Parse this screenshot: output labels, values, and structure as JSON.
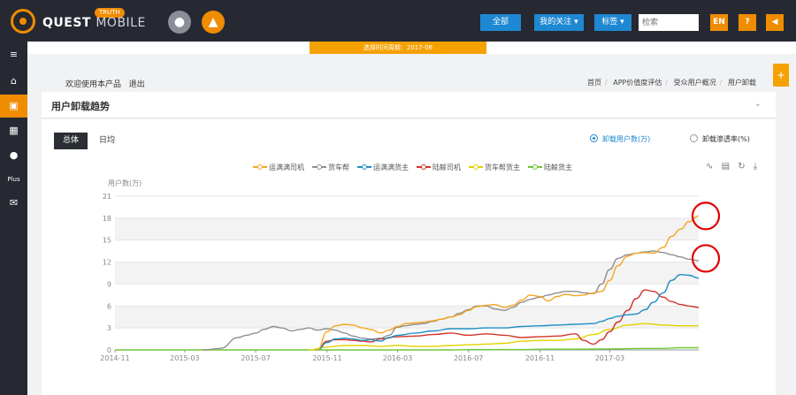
{
  "header": {
    "brand": "QUEST",
    "brand_sub": "MOBILE",
    "truth_badge": "TRUTH",
    "os_icons": [
      "apple-icon",
      "android-icon"
    ],
    "nav": {
      "all_label": "全部",
      "follow_label": "我的关注 ▾",
      "tag_label": "标签 ▾",
      "search_placeholder": "检索",
      "en_label": "EN",
      "help_label": "?",
      "sound_label": "◀"
    }
  },
  "period_label": "选择时间周期：2017-06",
  "sidebar": {
    "items": [
      {
        "icon": "menu-icon",
        "label": "≡"
      },
      {
        "icon": "home-icon",
        "label": "⌂"
      },
      {
        "icon": "briefcase-icon",
        "label": "▣"
      },
      {
        "icon": "grid-icon",
        "label": "▦"
      },
      {
        "icon": "user-icon",
        "label": "●"
      },
      {
        "icon": "plus-text",
        "label": "Plus"
      },
      {
        "icon": "mail-icon",
        "label": "✉"
      }
    ]
  },
  "welcome": {
    "text": "欢迎使用本产品",
    "logout": "退出"
  },
  "breadcrumb": [
    "首页",
    "APP价值度评估",
    "受众用户概况",
    "用户卸载"
  ],
  "floating_add": "+",
  "card": {
    "title": "用户卸载趋势",
    "tabs": {
      "total": "总体",
      "daily": "日均"
    },
    "radios": {
      "users": "卸载用户数(万)",
      "rate": "卸载渗透率(%)"
    }
  },
  "colors": {
    "accent": "#f08c00",
    "topbar": "#262932",
    "button_blue": "#1e88d2",
    "annotation_red": "#e00000"
  },
  "chart_data": {
    "type": "line",
    "ylabel": "用户数(万)",
    "ylim": [
      0,
      21
    ],
    "yticks": [
      0,
      3,
      6,
      9,
      12,
      15,
      18,
      21
    ],
    "xlim": [
      "2014-11",
      "2017-08"
    ],
    "xticks": [
      "2014-11",
      "2015-03",
      "2015-07",
      "2015-11",
      "2016-03",
      "2016-07",
      "2016-11",
      "2017-03"
    ],
    "grid": "horizontal-bands",
    "legend_placement": "top",
    "annotations": [
      {
        "shape": "circle",
        "at": {
          "x": "2017-08",
          "y": 18.3
        }
      },
      {
        "shape": "circle",
        "at": {
          "x": "2017-08",
          "y": 12.5
        }
      }
    ],
    "series": [
      {
        "name": "运满满司机",
        "color": "#f5a623",
        "x": [
          "2015-10-15",
          "2015-11-01",
          "2015-11-15",
          "2015-12-01",
          "2015-12-15",
          "2016-01-01",
          "2016-01-15",
          "2016-02-01",
          "2016-02-15",
          "2016-03-01",
          "2016-03-15",
          "2016-04-01",
          "2016-04-15",
          "2016-05-01",
          "2016-05-15",
          "2016-06-01",
          "2016-06-15",
          "2016-07-01",
          "2016-07-15",
          "2016-08-01",
          "2016-08-15",
          "2016-09-01",
          "2016-09-15",
          "2016-10-01",
          "2016-10-15",
          "2016-11-01",
          "2016-11-15",
          "2016-12-01",
          "2016-12-15",
          "2017-01-01",
          "2017-01-15",
          "2017-02-01",
          "2017-02-15",
          "2017-03-01",
          "2017-03-15",
          "2017-04-01",
          "2017-04-15",
          "2017-05-01",
          "2017-05-15",
          "2017-06-01",
          "2017-06-15",
          "2017-07-01",
          "2017-07-15",
          "2017-08-01"
        ],
        "values": [
          0,
          2.5,
          3.3,
          3.5,
          3.4,
          3.0,
          2.8,
          2.3,
          2.7,
          3.2,
          3.6,
          3.7,
          3.8,
          4.0,
          4.2,
          4.5,
          4.8,
          5.4,
          5.9,
          6.1,
          6.2,
          5.8,
          6.1,
          6.8,
          7.5,
          7.3,
          6.7,
          7.3,
          7.6,
          7.4,
          7.5,
          7.8,
          8.0,
          9.5,
          11.5,
          12.8,
          13.2,
          13.3,
          13.2,
          14.0,
          15.5,
          16.5,
          17.5,
          18.3
        ]
      },
      {
        "name": "货车帮",
        "color": "#8e8e93",
        "x": [
          "2015-04-01",
          "2015-05-01",
          "2015-06-01",
          "2015-06-15",
          "2015-07-01",
          "2015-07-15",
          "2015-08-01",
          "2015-08-15",
          "2015-09-01",
          "2015-09-15",
          "2015-10-01",
          "2015-10-15",
          "2015-11-01",
          "2015-11-15",
          "2015-12-01",
          "2015-12-15",
          "2016-01-01",
          "2016-01-15",
          "2016-02-01",
          "2016-02-15",
          "2016-03-01",
          "2016-03-15",
          "2016-04-01",
          "2016-04-15",
          "2016-05-01",
          "2016-05-15",
          "2016-06-01",
          "2016-06-15",
          "2016-07-01",
          "2016-07-15",
          "2016-08-01",
          "2016-08-15",
          "2016-09-01",
          "2016-09-15",
          "2016-10-01",
          "2016-10-15",
          "2016-11-01",
          "2016-11-15",
          "2016-12-01",
          "2016-12-15",
          "2017-01-01",
          "2017-01-15",
          "2017-02-01",
          "2017-02-15",
          "2017-03-01",
          "2017-03-15",
          "2017-04-01",
          "2017-04-15",
          "2017-05-01",
          "2017-05-15",
          "2017-06-01",
          "2017-06-15",
          "2017-07-01",
          "2017-07-15",
          "2017-08-01"
        ],
        "values": [
          0,
          0.2,
          1.7,
          2.0,
          2.3,
          2.8,
          3.2,
          3.0,
          2.6,
          2.8,
          3.0,
          2.7,
          2.9,
          2.7,
          2.3,
          1.9,
          1.6,
          1.5,
          1.6,
          2.0,
          3.1,
          3.3,
          3.5,
          3.6,
          3.9,
          4.2,
          4.5,
          5.0,
          5.5,
          6.0,
          6.0,
          5.6,
          5.4,
          5.8,
          6.5,
          6.9,
          7.2,
          7.5,
          7.8,
          8.0,
          8.0,
          7.8,
          7.7,
          9.0,
          11.0,
          12.5,
          13.0,
          13.2,
          13.4,
          13.5,
          13.3,
          13.0,
          12.7,
          12.4,
          12.2
        ]
      },
      {
        "name": "运满满货主",
        "color": "#1e8fc6",
        "x": [
          "2015-10-15",
          "2015-11-01",
          "2015-11-15",
          "2015-12-01",
          "2015-12-15",
          "2016-01-01",
          "2016-01-15",
          "2016-02-01",
          "2016-02-15",
          "2016-03-01",
          "2016-04-01",
          "2016-05-01",
          "2016-06-01",
          "2016-07-01",
          "2016-08-01",
          "2016-09-01",
          "2016-10-01",
          "2016-11-01",
          "2016-12-01",
          "2017-01-01",
          "2017-02-01",
          "2017-02-15",
          "2017-03-01",
          "2017-03-15",
          "2017-04-01",
          "2017-04-15",
          "2017-05-01",
          "2017-05-15",
          "2017-06-01",
          "2017-06-15",
          "2017-07-01",
          "2017-07-15",
          "2017-08-01"
        ],
        "values": [
          0,
          1.0,
          1.5,
          1.6,
          1.5,
          1.3,
          1.4,
          1.2,
          1.7,
          2.0,
          2.3,
          2.6,
          2.9,
          2.9,
          3.0,
          3.0,
          3.2,
          3.3,
          3.4,
          3.5,
          3.6,
          3.9,
          4.3,
          4.6,
          4.8,
          4.9,
          5.5,
          6.5,
          7.8,
          9.5,
          10.3,
          10.2,
          9.8
        ]
      },
      {
        "name": "陆鲸司机",
        "color": "#d0342c",
        "x": [
          "2015-10-15",
          "2015-11-01",
          "2015-11-15",
          "2015-12-01",
          "2015-12-15",
          "2016-01-01",
          "2016-01-15",
          "2016-02-01",
          "2016-03-01",
          "2016-04-01",
          "2016-05-01",
          "2016-06-01",
          "2016-07-01",
          "2016-08-01",
          "2016-09-01",
          "2016-10-01",
          "2016-11-01",
          "2016-12-01",
          "2017-01-01",
          "2017-01-15",
          "2017-02-01",
          "2017-02-15",
          "2017-03-01",
          "2017-03-15",
          "2017-04-01",
          "2017-04-15",
          "2017-05-01",
          "2017-05-15",
          "2017-06-01",
          "2017-06-15",
          "2017-07-01",
          "2017-07-15",
          "2017-08-01"
        ],
        "values": [
          0,
          1.2,
          1.4,
          1.4,
          1.3,
          1.2,
          1.1,
          1.5,
          1.8,
          1.9,
          2.1,
          2.3,
          2.0,
          2.2,
          2.0,
          1.7,
          1.8,
          1.9,
          2.2,
          1.3,
          0.8,
          1.4,
          2.5,
          3.8,
          5.4,
          7.0,
          8.2,
          8.0,
          7.2,
          6.6,
          6.2,
          6.0,
          5.8
        ]
      },
      {
        "name": "货车帮货主",
        "color": "#e2d200",
        "x": [
          "2015-10-01",
          "2015-11-01",
          "2015-12-01",
          "2016-01-01",
          "2016-02-01",
          "2016-03-01",
          "2016-04-01",
          "2016-05-01",
          "2016-06-01",
          "2016-07-01",
          "2016-08-01",
          "2016-09-01",
          "2016-10-01",
          "2016-11-01",
          "2016-12-01",
          "2017-01-01",
          "2017-02-01",
          "2017-03-01",
          "2017-04-01",
          "2017-05-01",
          "2017-06-01",
          "2017-07-01",
          "2017-08-01"
        ],
        "values": [
          0,
          0.4,
          0.6,
          0.6,
          0.5,
          0.6,
          0.5,
          0.5,
          0.6,
          0.7,
          0.8,
          0.9,
          1.2,
          1.3,
          1.3,
          1.5,
          2.1,
          2.8,
          3.4,
          3.6,
          3.4,
          3.3,
          3.3
        ]
      },
      {
        "name": "陆鲸货主",
        "color": "#6fc936",
        "x": [
          "2014-11-01",
          "2016-06-01",
          "2016-07-01",
          "2016-10-01",
          "2016-11-01",
          "2017-01-01",
          "2017-03-01",
          "2017-05-01",
          "2017-06-01",
          "2017-07-01",
          "2017-08-01"
        ],
        "values": [
          0,
          0,
          0.05,
          0.05,
          0.1,
          0.1,
          0.15,
          0.2,
          0.2,
          0.3,
          0.3
        ]
      }
    ]
  }
}
